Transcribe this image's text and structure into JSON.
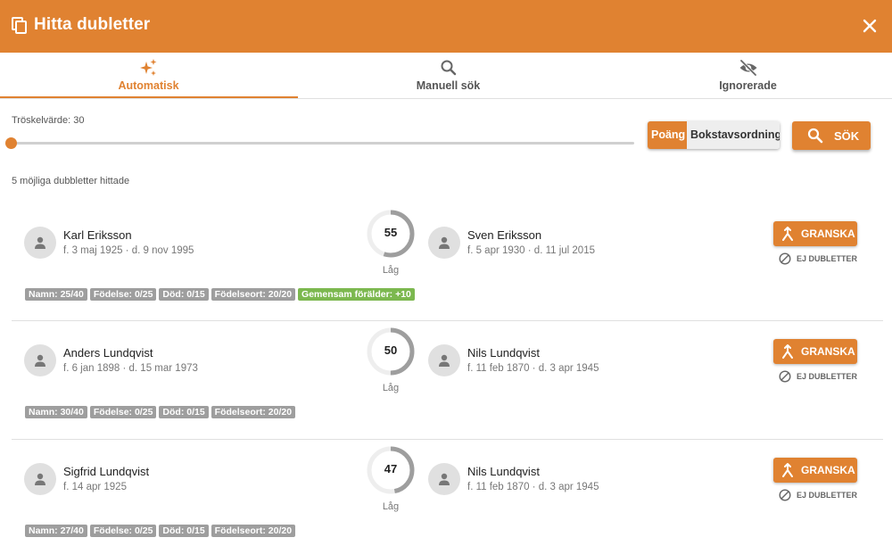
{
  "dialog": {
    "title": "Hitta dubletter",
    "icons": {
      "title": "copy-icon",
      "close": "close-icon"
    }
  },
  "tabs": [
    {
      "label": "Automatisk",
      "icon": "sparkles-icon",
      "active": true
    },
    {
      "label": "Manuell sök",
      "icon": "search-icon",
      "active": false
    },
    {
      "label": "Ignorerade",
      "icon": "eye-off-icon",
      "active": false
    }
  ],
  "controls": {
    "threshold_label": "Tröskelvärde: 30",
    "threshold_value": 30,
    "sort_options": [
      "Poäng",
      "Bokstavsordning"
    ],
    "sort_selected": "Poäng",
    "search_label": "SÖK"
  },
  "results": {
    "summary": "5 möjliga dubbletter hittade",
    "review_label": "GRANSKA",
    "not_duplicates_label": "EJ DUBLETTER",
    "items": [
      {
        "person_a": {
          "name": "Karl Eriksson",
          "dates": "f. 3 maj 1925 · d. 9 nov 1995"
        },
        "person_b": {
          "name": "Sven Eriksson",
          "dates": "f. 5 apr 1930 · d. 11 jul 2015"
        },
        "score": "55",
        "level": "Låg",
        "badges": [
          {
            "text": "Namn: 25/40",
            "color": "#9e9e9e"
          },
          {
            "text": "Födelse: 0/25",
            "color": "#9e9e9e"
          },
          {
            "text": "Död: 0/15",
            "color": "#9e9e9e"
          },
          {
            "text": "Födelseort: 20/20",
            "color": "#9e9e9e"
          },
          {
            "text": "Gemensam förälder: +10",
            "color": "#7cb84f"
          }
        ]
      },
      {
        "person_a": {
          "name": "Anders Lundqvist",
          "dates": "f. 6 jan 1898 · d. 15 mar 1973"
        },
        "person_b": {
          "name": "Nils Lundqvist",
          "dates": "f. 11 feb 1870 · d. 3 apr 1945"
        },
        "score": "50",
        "level": "Låg",
        "badges": [
          {
            "text": "Namn: 30/40",
            "color": "#9e9e9e"
          },
          {
            "text": "Födelse: 0/25",
            "color": "#9e9e9e"
          },
          {
            "text": "Död: 0/15",
            "color": "#9e9e9e"
          },
          {
            "text": "Födelseort: 20/20",
            "color": "#9e9e9e"
          }
        ]
      },
      {
        "person_a": {
          "name": "Sigfrid Lundqvist",
          "dates": "f. 14 apr 1925"
        },
        "person_b": {
          "name": "Nils Lundqvist",
          "dates": "f. 11 feb 1870 · d. 3 apr 1945"
        },
        "score": "47",
        "level": "Låg",
        "badges": [
          {
            "text": "Namn: 27/40",
            "color": "#9e9e9e"
          },
          {
            "text": "Födelse: 0/25",
            "color": "#9e9e9e"
          },
          {
            "text": "Död: 0/15",
            "color": "#9e9e9e"
          },
          {
            "text": "Födelseort: 20/20",
            "color": "#9e9e9e"
          }
        ]
      }
    ]
  },
  "colors": {
    "accent": "#e08231",
    "badge_gray": "#9e9e9e",
    "badge_green": "#7cb84f"
  }
}
